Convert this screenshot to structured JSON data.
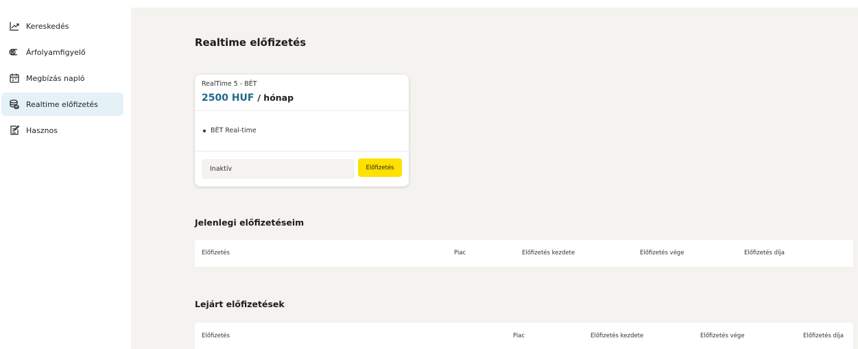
{
  "sidebar": {
    "items": [
      {
        "label": "Kereskedés",
        "icon": "chart-line-icon",
        "active": false
      },
      {
        "label": "Árfolyamfigyelő",
        "icon": "rate-watch-icon",
        "active": false
      },
      {
        "label": "Megbízás napló",
        "icon": "calendar-icon",
        "active": false
      },
      {
        "label": "Realtime előfizetés",
        "icon": "coins-icon",
        "active": true
      },
      {
        "label": "Hasznos",
        "icon": "edit-document-icon",
        "active": false
      }
    ]
  },
  "page": {
    "title": "Realtime előfizetés"
  },
  "card": {
    "subtitle": "RealTime 5 - BÉT",
    "price": "2500 HUF",
    "period": "/ hónap",
    "feature": "BÉT Real-time",
    "status": "Inaktív",
    "button": "Előfizetés"
  },
  "current": {
    "title": "Jelenlegi előfizetéseim",
    "columns": [
      "Előfizetés",
      "Piac",
      "Előfizetés kezdete",
      "Előfizetés vége",
      "Előfizetés díja"
    ]
  },
  "expired": {
    "title": "Lejárt előfizetések",
    "columns": [
      "Előfizetés",
      "Piac",
      "Előfizetés kezdete",
      "Előfizetés vége",
      "Előfizetés díja"
    ]
  },
  "colors": {
    "accent": "#1d6a8c",
    "button": "#ffe100",
    "active_nav": "#e4f1f7",
    "main_bg": "#f5f3ef"
  }
}
